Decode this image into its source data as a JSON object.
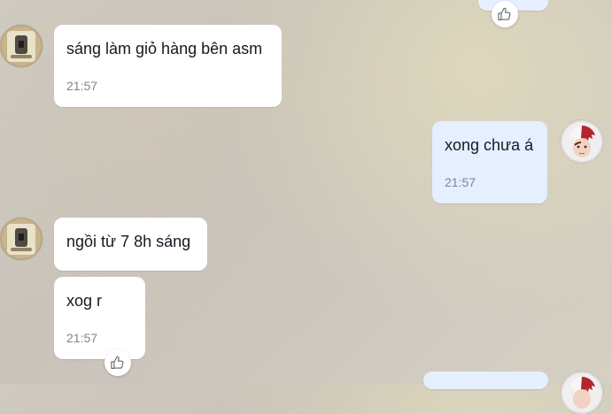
{
  "conversation": {
    "messages": [
      {
        "text": "sáng làm giỏ hàng bên asm",
        "time": "21:57",
        "direction": "incoming"
      },
      {
        "text": "xong chưa á",
        "time": "21:57",
        "direction": "outgoing"
      },
      {
        "text": "ngồi từ 7 8h sáng",
        "time": "",
        "direction": "incoming"
      },
      {
        "text": "xog r",
        "time": "21:57",
        "direction": "incoming"
      }
    ]
  },
  "theme": {
    "incoming_bubble": "#ffffff",
    "outgoing_bubble": "#e5efff",
    "time_color": "#7b8592"
  },
  "icons": {
    "reaction": "thumbs-up-icon"
  }
}
